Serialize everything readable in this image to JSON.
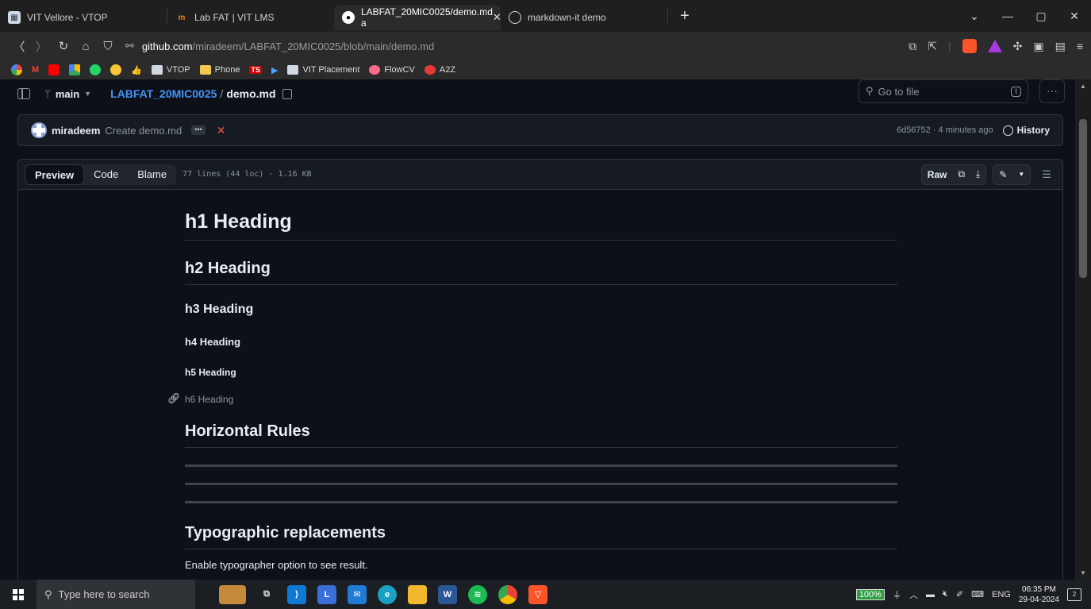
{
  "browser": {
    "tabs": [
      {
        "title": "VIT Vellore - VTOP",
        "favicon": "vtop-icon",
        "active": false
      },
      {
        "title": "Lab FAT | VIT LMS",
        "favicon": "moodle-icon",
        "active": false
      },
      {
        "title": "LABFAT_20MIC0025/demo.md a",
        "favicon": "github-icon",
        "active": true
      },
      {
        "title": "markdown-it demo",
        "favicon": "globe-icon",
        "active": false
      }
    ],
    "url_host": "github.com",
    "url_path": "/miradeem/LABFAT_20MIC0025/blob/main/demo.md",
    "bookmarks": [
      "VTOP",
      "Phone",
      "VIT Placement",
      "FlowCV",
      "A2Z"
    ],
    "bookmark_badge": "TS",
    "zoom_badge": "3"
  },
  "repo": {
    "branch": "main",
    "name": "LABFAT_20MIC0025",
    "file": "demo.md",
    "goto_placeholder": "Go to file",
    "goto_key": "t"
  },
  "commit": {
    "author": "miradeem",
    "message": "Create demo.md",
    "meta": "6d56752 · 4 minutes ago",
    "history_label": "History"
  },
  "file_header": {
    "tabs": [
      "Preview",
      "Code",
      "Blame"
    ],
    "selected_tab": "Preview",
    "info": "77 lines (44 loc) · 1.16 KB",
    "raw_label": "Raw"
  },
  "markdown": {
    "h1": "h1 Heading",
    "h2": "h2 Heading",
    "h3": "h3 Heading",
    "h4": "h4 Heading",
    "h5": "h5 Heading",
    "h6": "h6 Heading",
    "section_hr": "Horizontal Rules",
    "section_typo": "Typographic replacements",
    "typo_text": "Enable typographer option to see result."
  },
  "taskbar": {
    "search_placeholder": "Type here to search",
    "battery": "100%",
    "lang": "ENG",
    "time": "06:35 PM",
    "date": "29-04-2024",
    "notifications": "2",
    "lms_badge": "7"
  }
}
